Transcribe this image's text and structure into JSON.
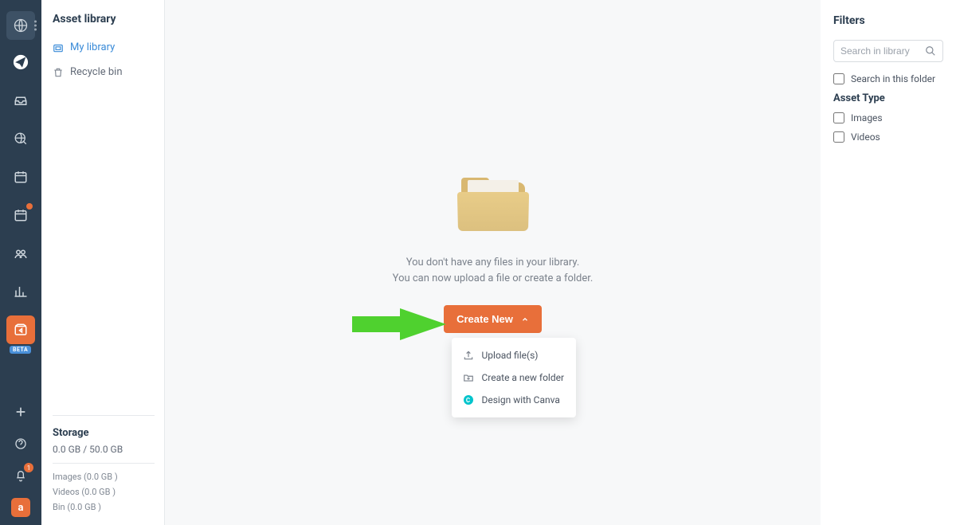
{
  "sidebar": {
    "title": "Asset library",
    "my_library": "My library",
    "recycle_bin": "Recycle bin"
  },
  "storage": {
    "title": "Storage",
    "usage": "0.0 GB / 50.0 GB",
    "images": "Images (0.0 GB )",
    "videos": "Videos (0.0 GB )",
    "bin": "Bin (0.0 GB )"
  },
  "main": {
    "empty_line1": "You don't have any files in your library.",
    "empty_line2": "You can now upload a file or create a folder.",
    "create_new": "Create New",
    "menu": {
      "upload": "Upload file(s)",
      "new_folder": "Create a new folder",
      "canva": "Design with Canva"
    }
  },
  "filters": {
    "title": "Filters",
    "search_placeholder": "Search in library",
    "search_in_folder": "Search in this folder",
    "asset_type_heading": "Asset Type",
    "images": "Images",
    "videos": "Videos"
  },
  "rail": {
    "beta": "BETA",
    "notif_count": "1"
  }
}
